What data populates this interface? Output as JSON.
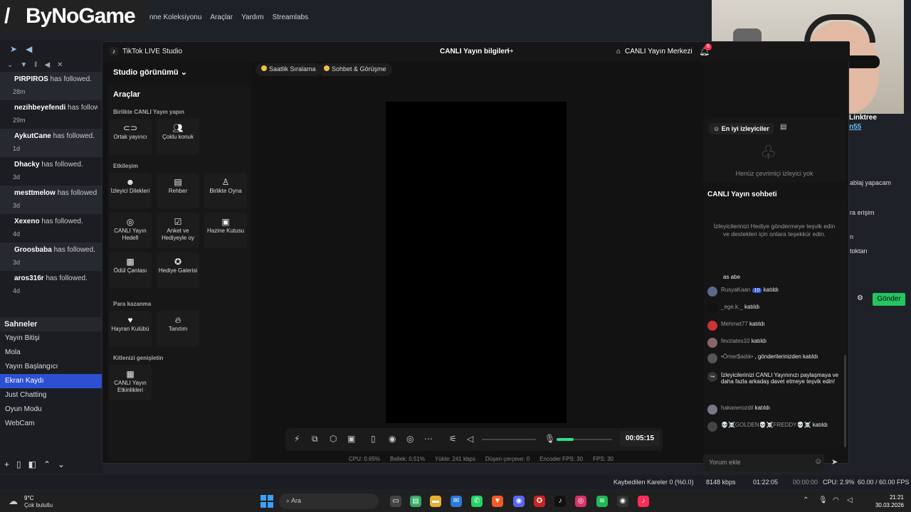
{
  "brand": {
    "name": "ByNoGame"
  },
  "obs_menu": [
    "nne Koleksiyonu",
    "Araçlar",
    "Yardım",
    "Streamlabs"
  ],
  "follows": [
    {
      "user": "PIRPIROS",
      "text": "has followed.",
      "time": "28m"
    },
    {
      "user": "nezihbeyefendi",
      "text": "has follow",
      "time": "29m"
    },
    {
      "user": "AykutCane",
      "text": "has followed.",
      "time": "1d"
    },
    {
      "user": "Dhacky",
      "text": "has followed.",
      "time": "3d"
    },
    {
      "user": "mesttmelow",
      "text": "has followed",
      "time": "3d"
    },
    {
      "user": "Xexeno",
      "text": "has followed.",
      "time": "4d"
    },
    {
      "user": "Groosbaba",
      "text": "has followed.",
      "time": "3d"
    },
    {
      "user": "aros316r",
      "text": "has followed.",
      "time": "4d"
    }
  ],
  "scenes": {
    "title": "Sahneler",
    "items": [
      "Yayın Bitişi",
      "Mola",
      "Yayın Başlangıcı",
      "Ekran Kaydı",
      "Just Chatting",
      "Oyun Modu",
      "WebCam"
    ],
    "active": "Ekran Kaydı"
  },
  "right_bg": {
    "linktree": "Linktree",
    "linktree_user": "n55",
    "lines": [
      "ablaj yapacam",
      "ra erişim",
      "n",
      "toktan"
    ],
    "send_label": "Gönder"
  },
  "tiktok": {
    "app_title": "TikTok LIVE Studio",
    "live_info": "CANLI Yayın bilgileri",
    "center": "CANLI Yayın Merkezi",
    "notif_count": "6",
    "studio_view": "Studio görünümü",
    "tools_title": "Araçlar",
    "sections": {
      "together": "Birlikte CANLI Yayın yapın",
      "interaction": "Etkileşim",
      "earn": "Para kazanma",
      "expand": "Kitlenizi genişletin"
    },
    "tools": {
      "cohost": "Ortak yayıncı",
      "multiguest": "Çoklu konuk",
      "viewer_requests": "İzleyici Dilekleri",
      "guide": "Rehber",
      "play_together": "Birlikte Oyna",
      "live_goal": "CANLI Yayın Hedefi",
      "poll": "Anket ve Hediyeyle oy",
      "treasure": "Hazine Kutusu",
      "reward_bag": "Ödül Çantası",
      "gift_gallery": "Hediye Galerisi",
      "fan_club": "Hayran Kulübü",
      "promo": "Tanıtım",
      "live_events": "CANLI Yayın Etkinlikleri"
    },
    "chips": {
      "ranking": "Saatlik Sıralama",
      "chat": "Sohbet & Görüşme"
    },
    "timer": "00:05:15",
    "stats": {
      "cpu": "CPU: 0.65%",
      "memory": "Bellek: 0.51%",
      "upload": "Yükle: 241 kbps",
      "dropped": "Düşen çerçeve: 0",
      "encoder_fps": "Encoder FPS: 30",
      "fps": "FPS: 30"
    },
    "viewers": {
      "tab": "En iyi izleyiciler",
      "empty": "Henüz çevrimiçi izleyici yok"
    },
    "chat": {
      "title": "CANLI Yayın sohbeti",
      "tip": "İzleyicilerinizi Hediye göndermeye teşvik edin ve destekleri için onlara teşekkür edin.",
      "partial": "as abe",
      "messages": [
        {
          "user": "RusyaKaan",
          "level": "10",
          "action": "katıldı"
        },
        {
          "user": "_ege.k._",
          "action": "katıldı"
        },
        {
          "user": "Mehmet77",
          "action": "katıldı"
        },
        {
          "user": "fevziates10",
          "action": "katıldı"
        },
        {
          "user": "•Ömer$adık•",
          "action": ", gönderilerinizden katıldı"
        },
        {
          "user": "hakanerozdil",
          "action": "katıldı"
        },
        {
          "user": "💀☠️GOLDEN💀☠️FREDDY💀☠️",
          "action": "katıldı"
        }
      ],
      "share_tip": "İzleyicilerinizi CANLI Yayınınızı paylaşmaya ve daha fazla arkadaş davet etmeye teşvik edin!",
      "input_placeholder": "Yorum ekle"
    }
  },
  "obs_status": {
    "dropped": "Kaybedilen Kareler 0 (%0.0)",
    "bitrate": "8148 kbps",
    "live_time": "01:22:05",
    "rec_time": "00:00:00",
    "cpu": "CPU: 2.9%",
    "fps": "60.00 / 60.00 FPS"
  },
  "taskbar": {
    "temp": "9°C",
    "weather": "Çok bulutlu",
    "search": "Ara",
    "time": "21:21",
    "date": "30.03.2026"
  }
}
